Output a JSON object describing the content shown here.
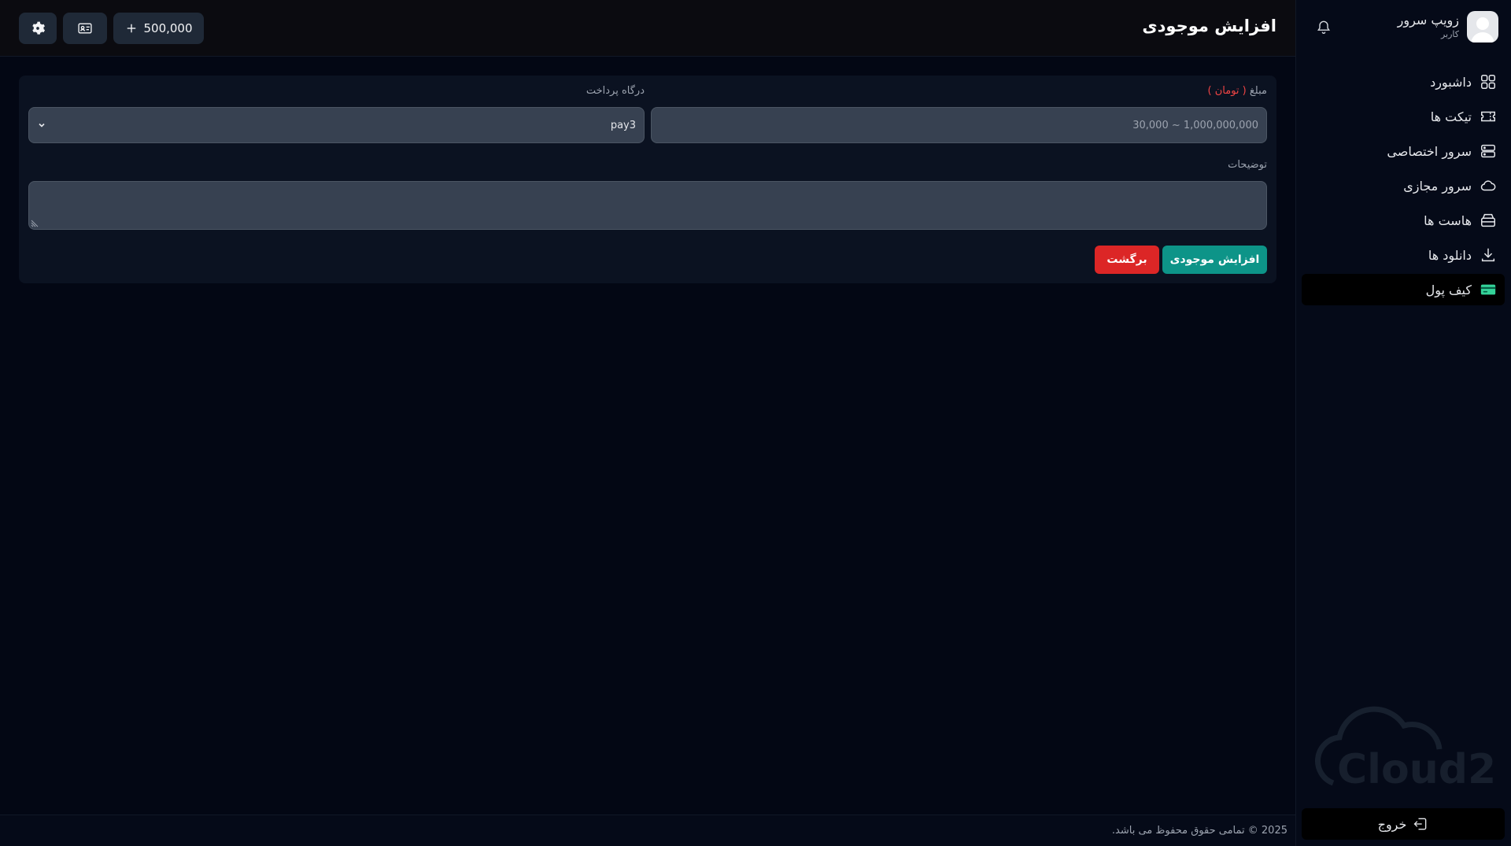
{
  "header": {
    "title": "افزایش موجودی",
    "balance": "500,000"
  },
  "profile": {
    "name": "زویپ سرور",
    "role": "کاربر"
  },
  "sidebar": {
    "items": [
      {
        "label": "داشبورد",
        "icon": "grid-icon"
      },
      {
        "label": "تیکت ها",
        "icon": "ticket-icon"
      },
      {
        "label": "سرور اختصاصی",
        "icon": "server-icon"
      },
      {
        "label": "سرور مجازی",
        "icon": "cloud-icon"
      },
      {
        "label": "هاست ها",
        "icon": "storage-icon"
      },
      {
        "label": "دانلود ها",
        "icon": "download-icon"
      },
      {
        "label": "کیف پول",
        "icon": "wallet-icon",
        "active": true
      }
    ],
    "logout": "خروج",
    "watermark": "Cloud2"
  },
  "form": {
    "amount_label": "مبلغ",
    "amount_unit": "( تومان )",
    "amount_placeholder": "30,000 ~ 1,000,000,000",
    "gateway_label": "درگاه پرداخت",
    "gateway_value": "pay3",
    "description_label": "توضیحات",
    "description_value": "",
    "submit_label": "افزایش موجودی",
    "back_label": "برگشت"
  },
  "footer": {
    "text": "2025 © تمامی حقوق محفوظ می باشد."
  },
  "colors": {
    "primary": "#0d9488",
    "danger": "#dc2626",
    "background": "#030714",
    "accent_unit": "#ef4444"
  }
}
